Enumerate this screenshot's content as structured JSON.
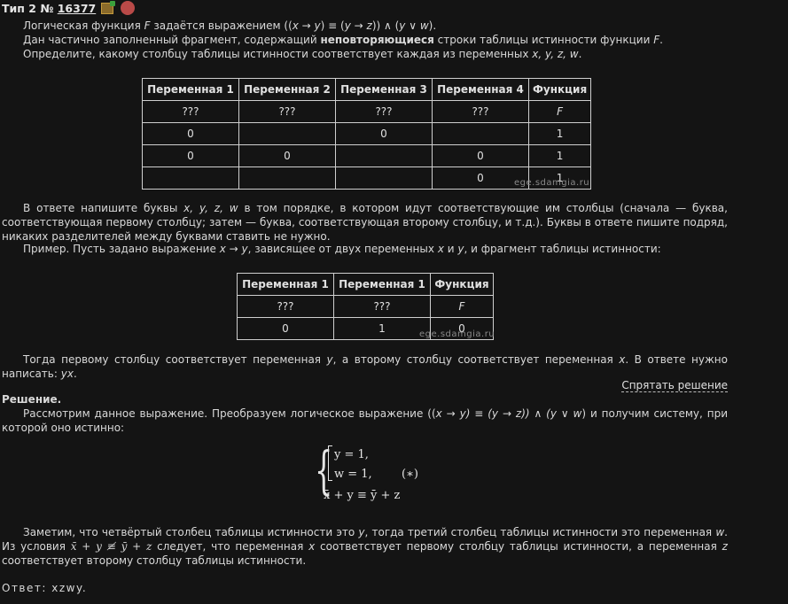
{
  "header": {
    "prefix": "Тип 2 №",
    "number": "16377"
  },
  "problem": {
    "line1_a": "Логическая функция",
    "line1_f": "F",
    "line1_b": "задаётся выражением ((",
    "expr_x": "x",
    "expr_mid1": " → ",
    "expr_y": "y",
    "expr_mid2": ") ≡ (",
    "expr_y2": "y",
    "expr_mid3": " → ",
    "expr_z": "z",
    "expr_mid4": ")) ∧ (",
    "expr_y3": "y",
    "expr_mid5": " ∨ ",
    "expr_w": "w",
    "expr_end": ").",
    "line2_a": "Дан частично заполненный фрагмент, содержащий",
    "line2_bold": "неповторяющиеся",
    "line2_b": "строки таблицы истинности функции",
    "line2_f": "F",
    "line3_a": "Определите, какому столбцу таблицы истинности соответствует каждая из переменных",
    "line3_vars": "x, y, z, w",
    "line3_end": "."
  },
  "table1": {
    "headers": [
      "Переменная 1",
      "Переменная 2",
      "Переменная 3",
      "Переменная 4",
      "Функция"
    ],
    "rows": [
      [
        "???",
        "???",
        "???",
        "???",
        "F"
      ],
      [
        "0",
        "",
        "0",
        "",
        "1"
      ],
      [
        "0",
        "0",
        "",
        "0",
        "1"
      ],
      [
        "",
        "",
        "",
        "0",
        "1"
      ]
    ],
    "watermark": "ege.sdamgia.ru"
  },
  "instructions": {
    "text1": "В ответе напишите буквы",
    "vars": "x, y, z, w",
    "text2": "в том порядке, в котором идут соответствующие им столбцы (сначала — буква, соответствующая первому столбцу; затем — буква, соответствующая второму столбцу, и т.д.). Буквы в ответе пишите подряд, никаких разделителей между буквами ставить не нужно.",
    "example_a": "Пример. Пусть задано выражение",
    "example_expr": "x → y",
    "example_b": ", зависящее от двух переменных",
    "example_x": "x",
    "example_and": "и",
    "example_y": "y",
    "example_c": ", и фрагмент таблицы истинности:"
  },
  "table2": {
    "headers": [
      "Переменная 1",
      "Переменная 1",
      "Функция"
    ],
    "rows": [
      [
        "???",
        "???",
        "F"
      ],
      [
        "0",
        "1",
        "0"
      ]
    ],
    "watermark": "ege.sdamgia.ru"
  },
  "then_text": {
    "a": "Тогда первому столбцу соответствует переменная",
    "y": "y",
    "b": ", а второму столбцу соответствует переменная",
    "x": "x",
    "c": ". В ответе нужно написать:",
    "ans": "yx",
    "end": "."
  },
  "toggle_solution": "Спрятать решение",
  "solution": {
    "title": "Решение.",
    "text_a": "Рассмотрим данное выражение. Преобразуем логическое выражение ((",
    "text_expr": "x → y) ≡ (y → z)) ∧ (y ∨ w",
    "text_b": ") и получим систему, при которой оно истинно:",
    "system": {
      "eq1": "y = 1,",
      "eq2": "w = 1,",
      "eq3": "x̄ + y ≡ ȳ + z",
      "mark": "(∗)"
    },
    "para2_a": "Заметим, что четвёртый столбец таблицы истинности это",
    "para2_y": "y",
    "para2_b": ", тогда третий столбец таблицы истинности это переменная",
    "para2_w": "w",
    "para2_c": ". Из условия",
    "para2_cond": "x̄ + y ≢ ȳ + z",
    "para2_d": "следует, что переменная",
    "para2_x": "x",
    "para2_e": "соответствует первому столбцу таблицы истинности, а переменная",
    "para2_z": "z",
    "para2_f": "соответствует второму столбцу таблицы истинности."
  },
  "answer": {
    "label": "Ответ:",
    "value": "xzwy."
  }
}
